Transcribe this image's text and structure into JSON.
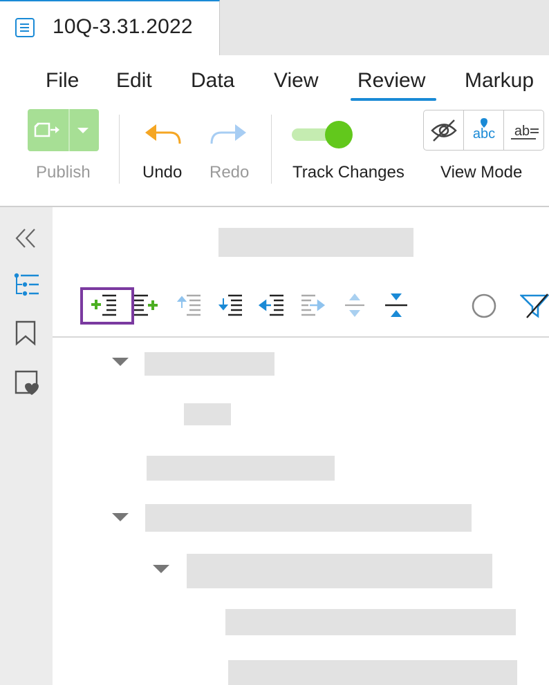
{
  "tab": {
    "title": "10Q-3.31.2022",
    "icon": "document-icon"
  },
  "menu": {
    "items": [
      "File",
      "Edit",
      "Data",
      "View",
      "Review",
      "Markup"
    ],
    "active": "Review"
  },
  "toolbar": {
    "publish_label": "Publish",
    "undo_label": "Undo",
    "redo_label": "Redo",
    "track_changes_label": "Track Changes",
    "track_changes_on": true,
    "view_mode_label": "View Mode",
    "view_mode_options": [
      "hidden-markup-icon",
      "show-markup-icon",
      "strikethrough-markup-icon"
    ]
  },
  "rail": {
    "icons": [
      "collapse-double-chevron-icon",
      "outline-list-icon",
      "bookmark-icon",
      "favorites-heart-icon"
    ]
  },
  "outline_toolbar": {
    "buttons": [
      "add-item-before-icon",
      "add-item-after-icon",
      "move-up-icon",
      "move-down-icon",
      "outdent-icon",
      "indent-icon",
      "expand-all-icon",
      "collapse-all-icon",
      "circle-icon",
      "filter-icon"
    ],
    "selected": "add-item-before-icon"
  },
  "colors": {
    "accent": "#1a8ad6",
    "publish_green": "#a7df95",
    "toggle_green": "#62c81c",
    "undo_orange": "#f5a623",
    "selection_purple": "#7b3aa0",
    "plus_green": "#4caf22"
  }
}
